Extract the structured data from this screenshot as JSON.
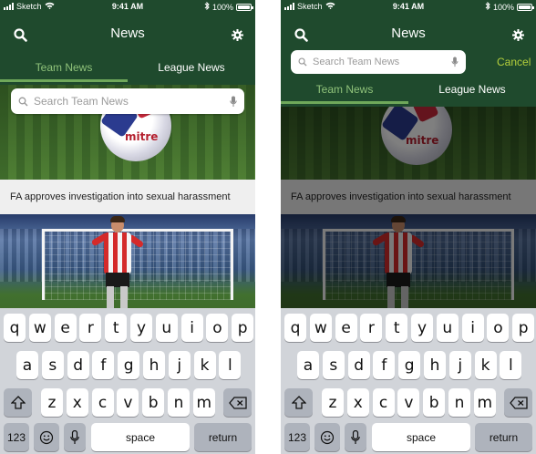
{
  "screens": [
    {
      "variant": "default",
      "status": {
        "carrier": "Sketch",
        "time": "9:41 AM",
        "battery": "100%"
      },
      "nav": {
        "title": "News"
      },
      "tabs": [
        {
          "label": "Team News",
          "active": true
        },
        {
          "label": "League News",
          "active": false
        }
      ],
      "search": {
        "placeholder": "Search Team News"
      },
      "hero": {
        "ball_brand": "mitre"
      },
      "article": {
        "headline": "FA approves investigation into sexual harassment"
      }
    },
    {
      "variant": "searching",
      "status": {
        "carrier": "Sketch",
        "time": "9:41 AM",
        "battery": "100%"
      },
      "nav": {
        "title": "News",
        "cancel": "Cancel"
      },
      "tabs": [
        {
          "label": "Team News",
          "active": true
        },
        {
          "label": "League News",
          "active": false
        }
      ],
      "search": {
        "placeholder": "Search Team News"
      },
      "hero": {
        "ball_brand": "mitre"
      },
      "article": {
        "headline": "FA approves investigation into sexual harassment"
      }
    }
  ],
  "keyboard": {
    "row1": [
      "q",
      "w",
      "e",
      "r",
      "t",
      "y",
      "u",
      "i",
      "o",
      "p"
    ],
    "row2": [
      "a",
      "s",
      "d",
      "f",
      "g",
      "h",
      "j",
      "k",
      "l"
    ],
    "row3": [
      "z",
      "x",
      "c",
      "v",
      "b",
      "n",
      "m"
    ],
    "numbers": "123",
    "space": "space",
    "return": "return"
  },
  "colors": {
    "header": "#1f4a2d",
    "active_tab": "#8fc27a",
    "cancel": "#b5cf3c"
  }
}
